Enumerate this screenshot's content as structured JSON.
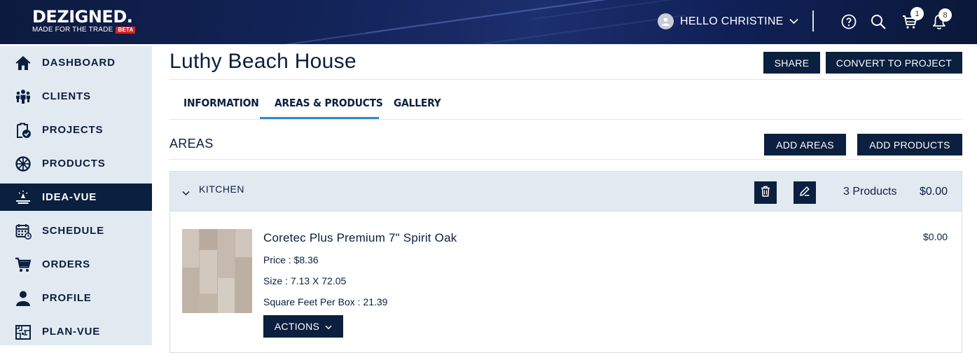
{
  "header": {
    "logo_main": "DEZIGNED.",
    "logo_tagline": "MADE FOR THE TRADE",
    "logo_badge": "BETA",
    "user_greeting": "HELLO CHRISTINE",
    "cart_count": "1",
    "notification_count": "8",
    "icons": [
      "user-avatar-icon",
      "chevron-down-icon",
      "help-icon",
      "search-icon",
      "cart-icon",
      "bell-icon"
    ]
  },
  "sidebar": {
    "items": [
      {
        "label": "DASHBOARD",
        "icon": "home-icon"
      },
      {
        "label": "CLIENTS",
        "icon": "clients-icon"
      },
      {
        "label": "PROJECTS",
        "icon": "clipboard-check-icon"
      },
      {
        "label": "PRODUCTS",
        "icon": "wheel-icon"
      },
      {
        "label": "IDEA-VUE",
        "icon": "idea-vue-icon",
        "active": true
      },
      {
        "label": "SCHEDULE",
        "icon": "calendar-icon"
      },
      {
        "label": "ORDERS",
        "icon": "cart-icon"
      },
      {
        "label": "PROFILE",
        "icon": "person-icon"
      },
      {
        "label": "PLAN-VUE",
        "icon": "floorplan-icon"
      }
    ]
  },
  "main": {
    "title": "Luthy Beach House",
    "share_label": "SHARE",
    "convert_label": "CONVERT TO PROJECT",
    "tabs": [
      {
        "label": "INFORMATION"
      },
      {
        "label": "AREAS & PRODUCTS",
        "active": true
      },
      {
        "label": "GALLERY"
      }
    ],
    "areas_title": "AREAS",
    "add_areas_label": "ADD AREAS",
    "add_products_label": "ADD PRODUCTS",
    "area": {
      "name": "KITCHEN",
      "product_count": "3 Products",
      "total": "$0.00",
      "product": {
        "name": "Coretec Plus Premium 7\" Spirit Oak",
        "price": "Price : $8.36",
        "size": "Size : 7.13 X 72.05",
        "sqft": "Square Feet Per Box : 21.39",
        "line_total": "$0.00",
        "actions_label": "ACTIONS"
      }
    }
  },
  "colors": {
    "navy": "#0b1f3f",
    "sidebar_bg": "#e2eaf1",
    "tab_accent": "#2f8bd0",
    "beta_red": "#d6232a"
  }
}
